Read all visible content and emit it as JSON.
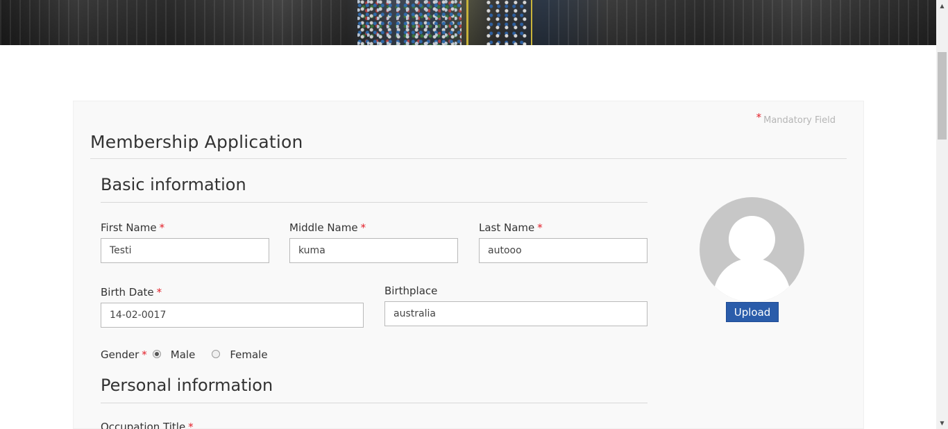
{
  "form": {
    "mandatory_note": "Mandatory Field",
    "required_mark": "*",
    "title": "Membership Application"
  },
  "basic": {
    "section_title": "Basic information",
    "first_name": {
      "label": "First Name",
      "value": "Testi"
    },
    "middle_name": {
      "label": "Middle Name",
      "value": "kuma"
    },
    "last_name": {
      "label": "Last Name",
      "value": "autooo"
    },
    "birth_date": {
      "label": "Birth Date",
      "value": "14-02-0017"
    },
    "birthplace": {
      "label": "Birthplace",
      "value": "australia"
    },
    "gender": {
      "label": "Gender",
      "options": [
        "Male",
        "Female"
      ],
      "selected": "Male"
    }
  },
  "personal": {
    "section_title": "Personal information",
    "occupation_title": {
      "label": "Occupation Title"
    }
  },
  "photo": {
    "upload_label": "Upload"
  }
}
